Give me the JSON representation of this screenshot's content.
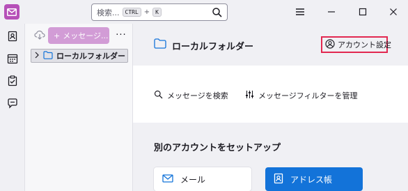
{
  "titlebar": {
    "search_placeholder": "検索...",
    "key_ctrl": "CTRL",
    "key_plus": "+",
    "key_k": "K"
  },
  "folderpane": {
    "new_message_label": "メッセージ...",
    "more_label": "···",
    "folder_name": "ローカルフォルダー"
  },
  "header": {
    "title": "ローカルフォルダー",
    "account_settings_label": "アカウント設定"
  },
  "actions": {
    "search_messages": "メッセージを検索",
    "manage_filters": "メッセージフィルターを管理"
  },
  "setup": {
    "title": "別のアカウントをセットアップ",
    "mail_label": "メール",
    "address_book_label": "アドレス帳"
  },
  "colors": {
    "accent_blue": "#1373d9",
    "app_purple": "#b650b8",
    "highlight_red": "#e22850"
  }
}
